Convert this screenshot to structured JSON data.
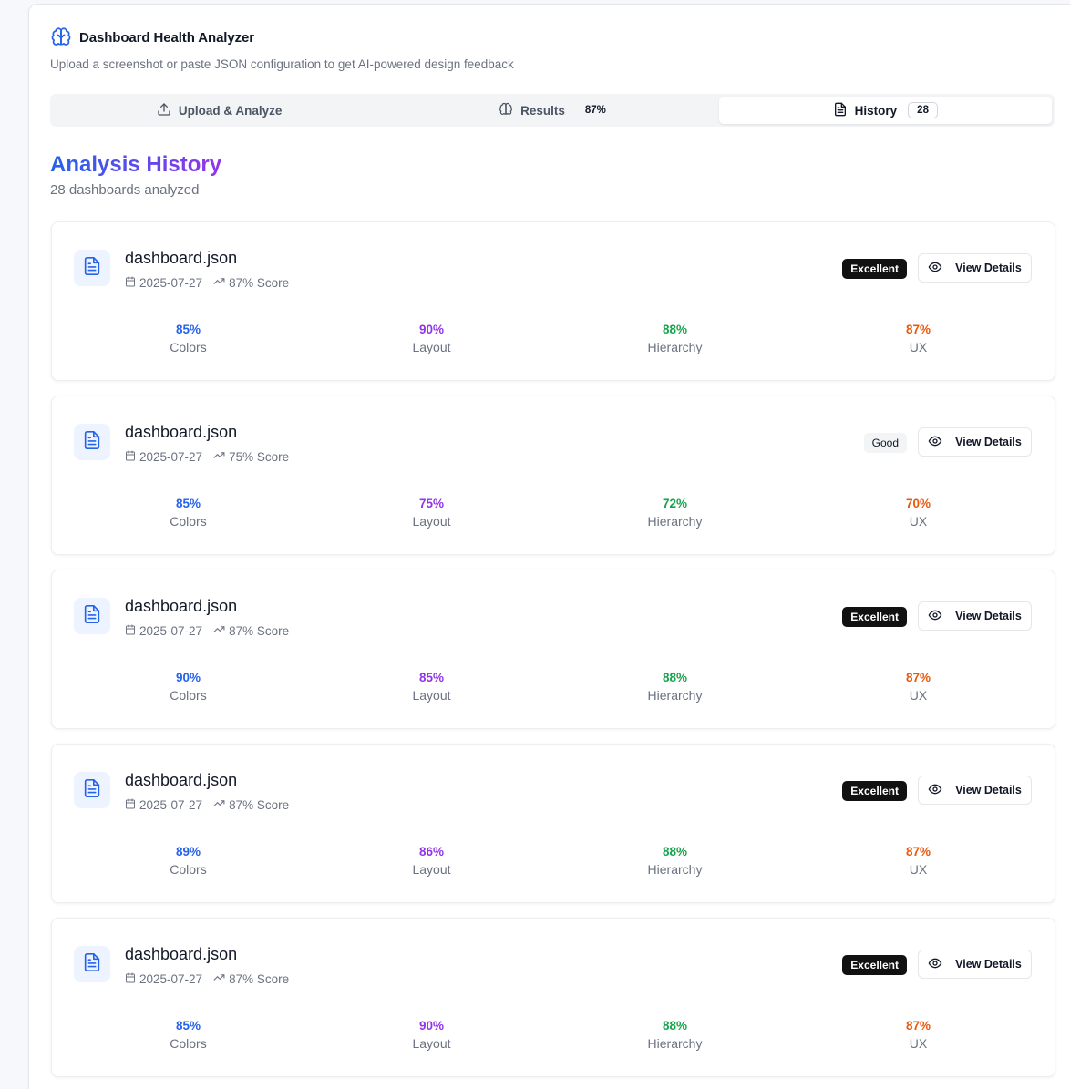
{
  "header": {
    "title": "Dashboard Health Analyzer",
    "subtitle": "Upload a screenshot or paste JSON configuration to get AI-powered design feedback"
  },
  "tabs": [
    {
      "label": "Upload & Analyze",
      "icon": "upload-icon"
    },
    {
      "label": "Results",
      "count": "87%",
      "icon": "brain-icon"
    },
    {
      "label": "History",
      "count": "28",
      "icon": "file-text-icon"
    }
  ],
  "history": {
    "title": "Analysis History",
    "subtitle": "28 dashboards analyzed",
    "view_label": "View Details",
    "metric_labels": [
      "Colors",
      "Layout",
      "Hierarchy",
      "UX"
    ],
    "items": [
      {
        "file": "dashboard.json",
        "date": "2025-07-27",
        "score": "87% Score",
        "badge": "Excellent",
        "metrics": [
          "85%",
          "90%",
          "88%",
          "87%"
        ]
      },
      {
        "file": "dashboard.json",
        "date": "2025-07-27",
        "score": "75% Score",
        "badge": "Good",
        "metrics": [
          "85%",
          "75%",
          "72%",
          "70%"
        ]
      },
      {
        "file": "dashboard.json",
        "date": "2025-07-27",
        "score": "87% Score",
        "badge": "Excellent",
        "metrics": [
          "90%",
          "85%",
          "88%",
          "87%"
        ]
      },
      {
        "file": "dashboard.json",
        "date": "2025-07-27",
        "score": "87% Score",
        "badge": "Excellent",
        "metrics": [
          "89%",
          "86%",
          "88%",
          "87%"
        ]
      },
      {
        "file": "dashboard.json",
        "date": "2025-07-27",
        "score": "87% Score",
        "badge": "Excellent",
        "metrics": [
          "85%",
          "90%",
          "88%",
          "87%"
        ]
      }
    ]
  },
  "colors": {
    "accent_blue": "#2563eb",
    "accent_purple": "#9333ea",
    "metric_colors": [
      "#2563eb",
      "#9333ea",
      "#16a34a",
      "#ea580c"
    ]
  }
}
